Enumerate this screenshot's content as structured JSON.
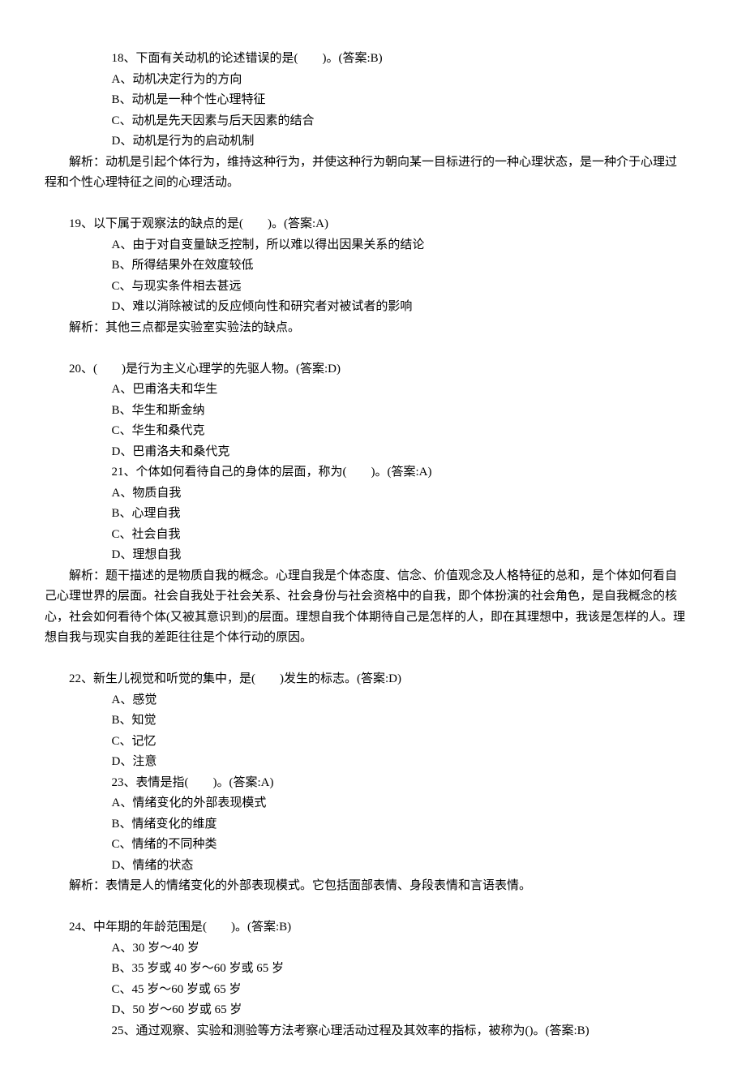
{
  "q18": {
    "stem": "18、下面有关动机的论述错误的是(　　)。(答案:B)",
    "A": "A、动机决定行为的方向",
    "B": "B、动机是一种个性心理特征",
    "C": "C、动机是先天因素与后天因素的结合",
    "D": "D、动机是行为的启动机制",
    "explain_l1": "解析：动机是引起个体行为，维持这种行为，并使这种行为朝向某一目标进行的一种心理状态，是一种介于心理过",
    "explain_l2": "程和个性心理特征之间的心理活动。"
  },
  "q19": {
    "stem": "19、以下属于观察法的缺点的是(　　)。(答案:A)",
    "A": "A、由于对自变量缺乏控制，所以难以得出因果关系的结论",
    "B": "B、所得结果外在效度较低",
    "C": "C、与现实条件相去甚远",
    "D": "D、难以消除被试的反应倾向性和研究者对被试者的影响",
    "explain": "解析：其他三点都是实验室实验法的缺点。"
  },
  "q20": {
    "stem": "20、(　　)是行为主义心理学的先驱人物。(答案:D)",
    "A": "A、巴甫洛夫和华生",
    "B": "B、华生和斯金纳",
    "C": "C、华生和桑代克",
    "D": "D、巴甫洛夫和桑代克"
  },
  "q21": {
    "stem": "21、个体如何看待自己的身体的层面，称为(　　)。(答案:A)",
    "A": "A、物质自我",
    "B": "B、心理自我",
    "C": "C、社会自我",
    "D": "D、理想自我",
    "explain_l1": "解析：题干描述的是物质自我的概念。心理自我是个体态度、信念、价值观念及人格特征的总和，是个体如何看自",
    "explain_l2": "己心理世界的层面。社会自我处于社会关系、社会身份与社会资格中的自我，即个体扮演的社会角色，是自我概念的核",
    "explain_l3": "心，社会如何看待个体(又被其意识到)的层面。理想自我个体期待自己是怎样的人，即在其理想中，我该是怎样的人。理",
    "explain_l4": "想自我与现实自我的差距往往是个体行动的原因。"
  },
  "q22": {
    "stem": "22、新生儿视觉和听觉的集中，是(　　)发生的标志。(答案:D)",
    "A": "A、感觉",
    "B": "B、知觉",
    "C": "C、记忆",
    "D": "D、注意"
  },
  "q23": {
    "stem": "23、表情是指(　　)。(答案:A)",
    "A": "A、情绪变化的外部表现模式",
    "B": "B、情绪变化的维度",
    "C": "C、情绪的不同种类",
    "D": "D、情绪的状态",
    "explain": "解析：表情是人的情绪变化的外部表现模式。它包括面部表情、身段表情和言语表情。"
  },
  "q24": {
    "stem": "24、中年期的年龄范围是(　　)。(答案:B)",
    "A": "A、30 岁～40 岁",
    "B": "B、35 岁或 40 岁～60 岁或 65 岁",
    "C": "C、45 岁～60 岁或 65 岁",
    "D": "D、50 岁～60 岁或 65 岁"
  },
  "q25": {
    "stem": "25、通过观察、实验和测验等方法考察心理活动过程及其效率的指标，被称为()。(答案:B)"
  }
}
